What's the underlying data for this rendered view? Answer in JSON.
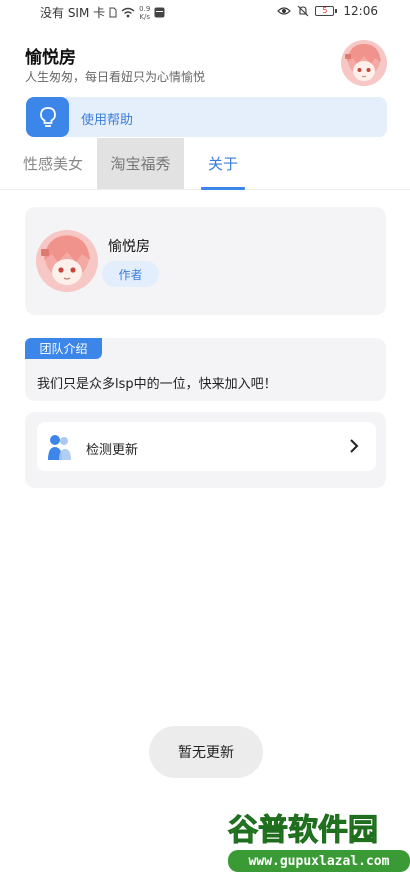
{
  "status_bar": {
    "carrier": "没有 SIM 卡",
    "net_speed_value": "0.9",
    "net_speed_unit": "K/s",
    "battery_level": "5",
    "time": "12:06"
  },
  "header": {
    "title": "愉悦房",
    "subtitle": "人生匆匆，每日看妞只为心情愉悦"
  },
  "help_banner": {
    "label": "使用帮助",
    "icon": "lightbulb-icon"
  },
  "tabs": [
    {
      "label": "性感美女",
      "state": "normal"
    },
    {
      "label": "淘宝福秀",
      "state": "pressed"
    },
    {
      "label": "关于",
      "state": "selected"
    }
  ],
  "author_card": {
    "name": "愉悦房",
    "role": "作者"
  },
  "team_card": {
    "tag": "团队介绍",
    "description": "我们只是众多lsp中的一位，快来加入吧！"
  },
  "update_card": {
    "label": "检测更新",
    "icon": "user-icon"
  },
  "toast": {
    "message": "暂无更新"
  },
  "watermark": {
    "name": "谷普软件园",
    "url": "www.gupuxlazal.com"
  },
  "colors": {
    "accent": "#3b86e8",
    "accent_text": "#3b7ddd",
    "card_bg": "#f4f4f6",
    "watermark_green": "#3a9a35"
  }
}
